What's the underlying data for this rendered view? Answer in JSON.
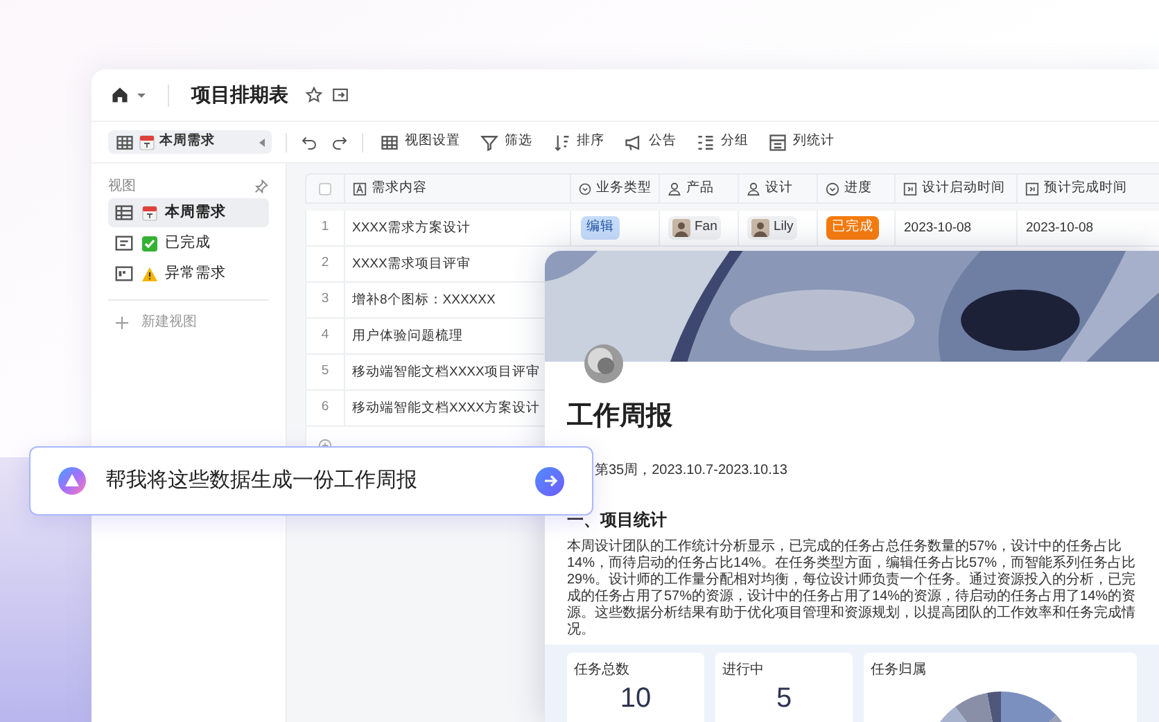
{
  "header": {
    "title": "项目排期表"
  },
  "toolbar": {
    "view_selector": "本周需求",
    "items": [
      {
        "label": "视图设置",
        "kind": "grid"
      },
      {
        "label": "筛选",
        "kind": "filter"
      },
      {
        "label": "排序",
        "kind": "sort"
      },
      {
        "label": "公告",
        "kind": "announce"
      },
      {
        "label": "分组",
        "kind": "group"
      },
      {
        "label": "列统计",
        "kind": "stats"
      }
    ]
  },
  "sidebar": {
    "heading": "视图",
    "items": [
      {
        "label": "本周需求",
        "kind": "grid",
        "selected": true
      },
      {
        "label": "已完成",
        "kind": "form",
        "selected": false
      },
      {
        "label": "异常需求",
        "kind": "kanban",
        "selected": false
      }
    ],
    "new_view": "新建视图"
  },
  "table": {
    "select_all": {
      "checked": false
    },
    "columns": [
      {
        "label": "需求内容",
        "kind": "text"
      },
      {
        "label": "业务类型",
        "kind": "select"
      },
      {
        "label": "产品",
        "kind": "person"
      },
      {
        "label": "设计",
        "kind": "person"
      },
      {
        "label": "进度",
        "kind": "select"
      },
      {
        "label": "设计启动时间",
        "kind": "date"
      },
      {
        "label": "预计完成时间",
        "kind": "date"
      }
    ],
    "rows": [
      {
        "index": "1",
        "content": "XXXX需求方案设计",
        "type": "编辑",
        "product": "Fan",
        "designer": "Lily",
        "progress": "已完成",
        "start": "2023-10-08",
        "due": "2023-10-08"
      },
      {
        "index": "2",
        "content": "XXXX需求项目评审"
      },
      {
        "index": "3",
        "content": "增补8个图标：XXXXXX"
      },
      {
        "index": "4",
        "content": "用户体验问题梳理"
      },
      {
        "index": "5",
        "content": "移动端智能文档XXXX项目评审"
      },
      {
        "index": "6",
        "content": "移动端智能文档XXXX方案设计"
      }
    ]
  },
  "document": {
    "title": "工作周报",
    "subtitle": "第35周，2023.10.7-2023.10.13",
    "section": "一、项目统计",
    "paragraph": "本周设计团队的工作统计分析显示，已完成的任务占总任务数量的57%，设计中的任务占比14%，而待启动的任务占比14%。在任务类型方面，编辑任务占比57%，而智能系列任务占比29%。设计师的工作量分配相对均衡，每位设计师负责一个任务。通过资源投入的分析，已完成的任务占用了57%的资源，设计中的任务占用了14%的资源，待启动的任务占用了14%的资源。这些数据分析结果有助于优化项目管理和资源规划，以提高团队的工作效率和任务完成情况。",
    "cards": [
      {
        "kind": "number",
        "label": "任务总数",
        "value": "10"
      },
      {
        "kind": "number",
        "label": "进行中",
        "value": "5"
      },
      {
        "kind": "pie",
        "label": "任务归属"
      }
    ]
  },
  "prompt": {
    "text": "帮我将这些数据生成一份工作周报"
  }
}
